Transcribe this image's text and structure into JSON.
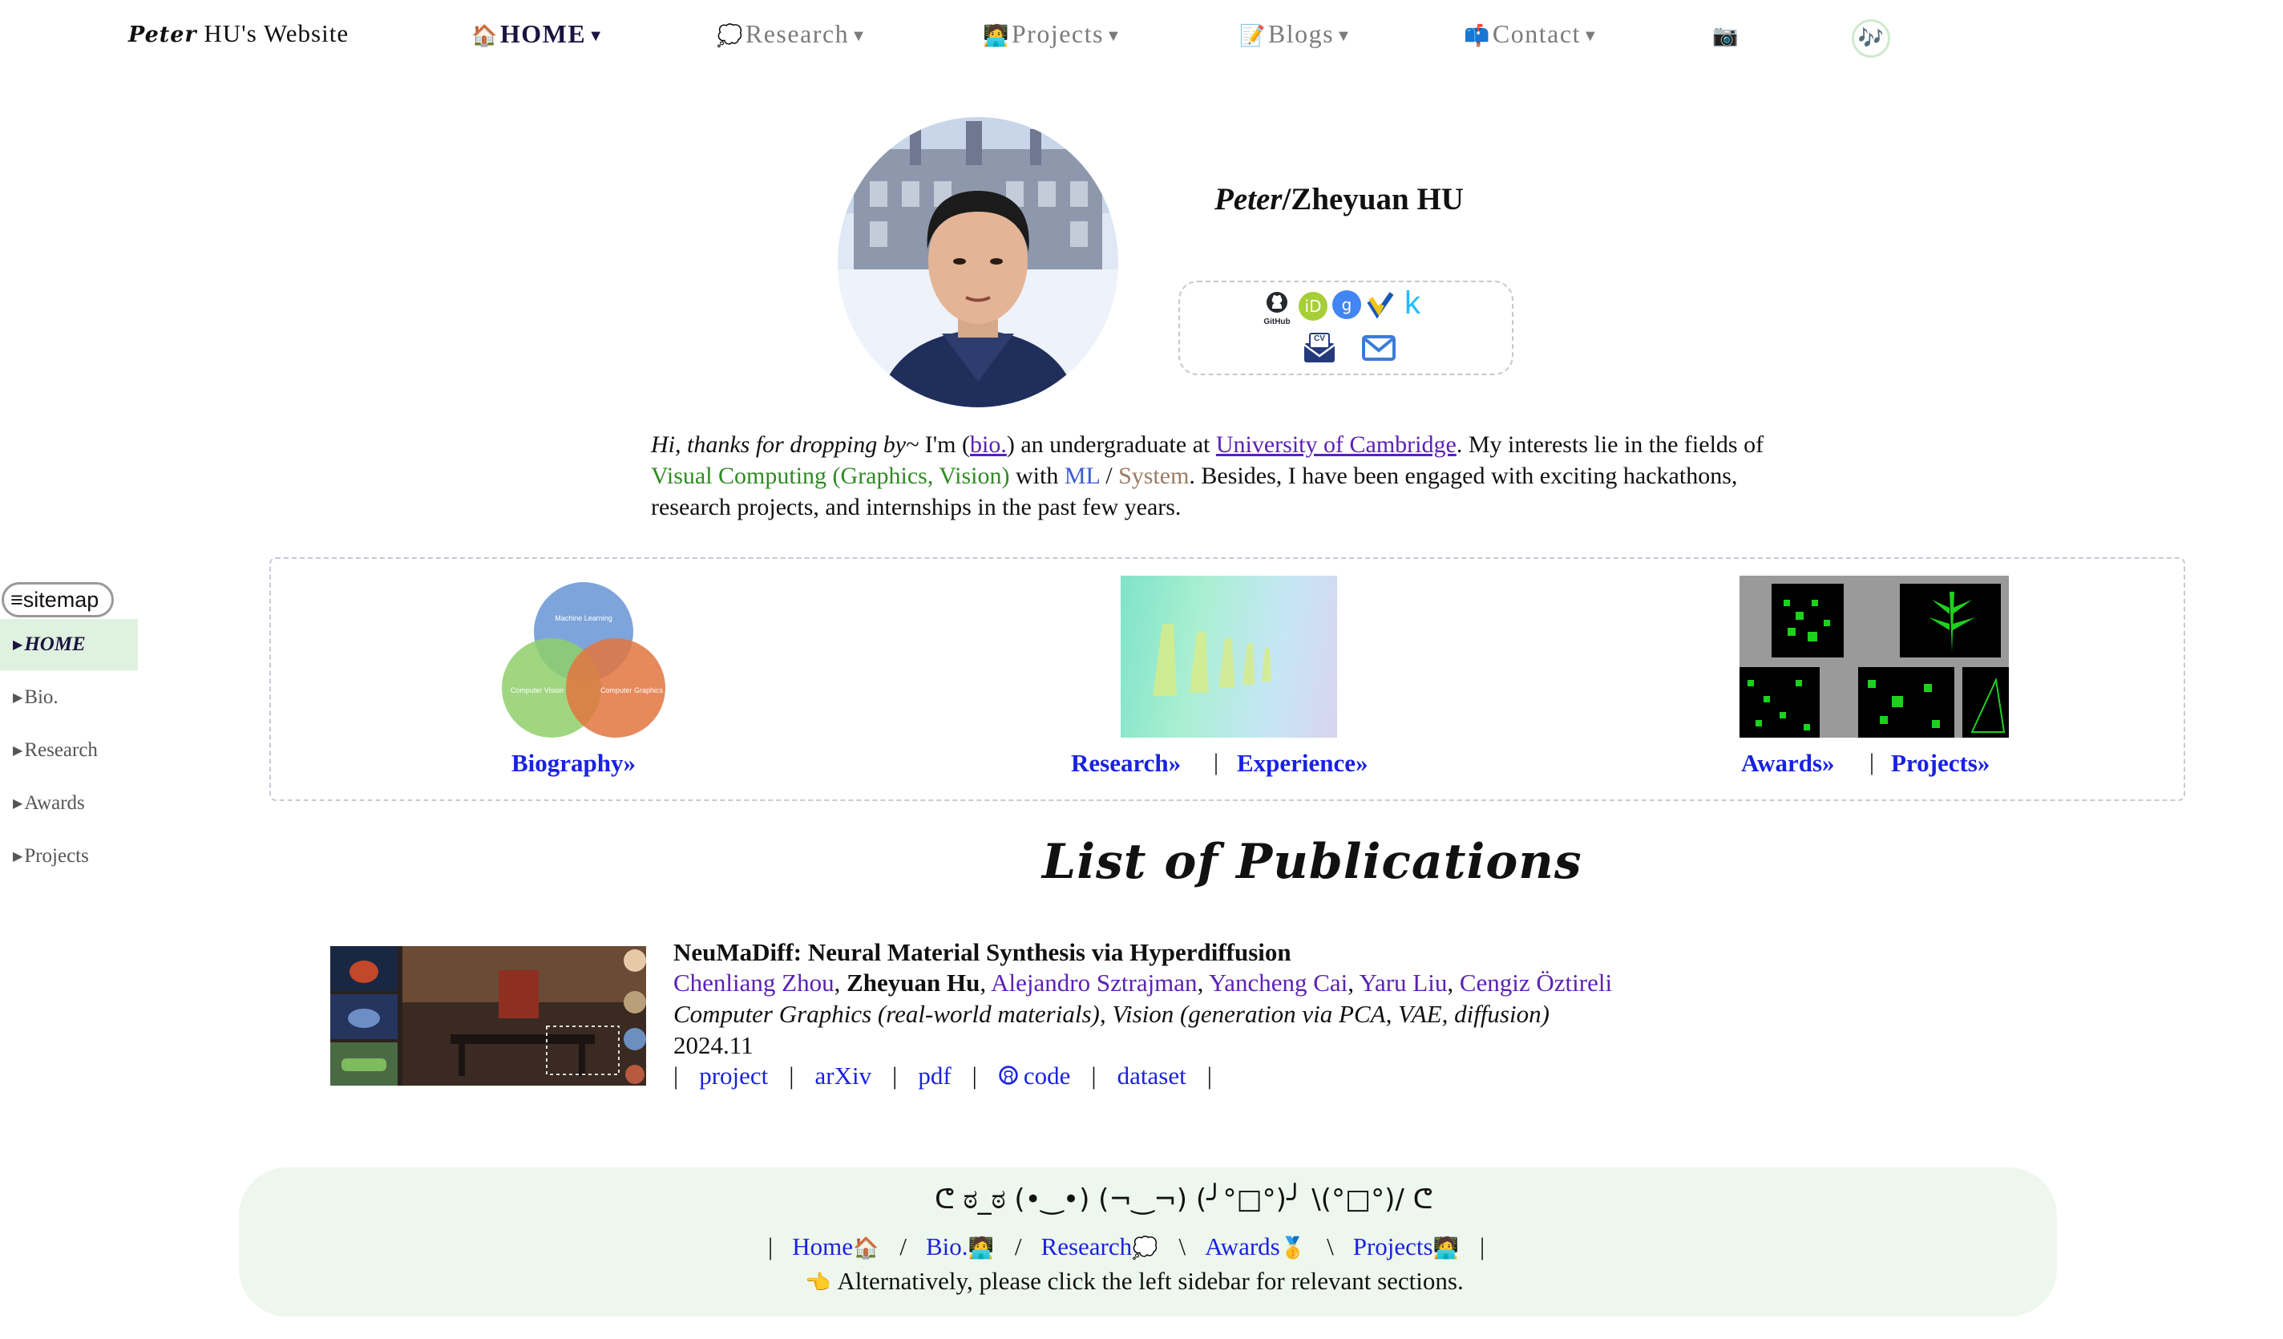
{
  "nav": {
    "brand": "Peter",
    "title_rest": " HU's Website",
    "items": [
      {
        "icon": "🏠",
        "label": "HOME"
      },
      {
        "icon": "💭",
        "label": "Research"
      },
      {
        "icon": "🧑‍💻",
        "label": "Projects"
      },
      {
        "icon": "📝",
        "label": "Blogs"
      },
      {
        "icon": "📫",
        "label": "Contact"
      }
    ],
    "camera_icon": "📷",
    "music_icon": "🎶"
  },
  "profile": {
    "nick": "Peter",
    "name_rest": "/Zheyuan HU",
    "links": [
      "GitHub",
      "ORCID",
      "Google Scholar",
      "Semantic Scholar",
      "Kaggle",
      "CV",
      "Email"
    ],
    "github_label": "GitHub",
    "cv_label": "CV"
  },
  "intro": {
    "greet": "Hi, thanks for dropping by~",
    "t1": " I'm (",
    "bio_link": "bio.",
    "t2": ") an undergraduate at ",
    "uni_link": "University of Cambridge",
    "t3": ". My interests lie in the fields of ",
    "vc": "Visual Computing (Graphics, Vision)",
    "t4": " with ",
    "ml": "ML",
    "t5": " / ",
    "sys": "System",
    "t6": ". Besides, I have been engaged with exciting hackathons, research projects, and internships in the past few years."
  },
  "sitemap": {
    "button": "≡sitemap",
    "items": [
      "HOME",
      "Bio.",
      "Research",
      "Awards",
      "Projects"
    ]
  },
  "cards": {
    "venn": {
      "ml": "Machine Learning",
      "cv": "Computer Vision",
      "cg": "Computer Graphics"
    },
    "biography": "Biography»",
    "research": "Research»",
    "experience": "Experience»",
    "awards": "Awards»",
    "projects": "Projects»",
    "sep": "|"
  },
  "publications": {
    "heading": "List of Publications",
    "items": [
      {
        "title": "NeuMaDiff: Neural Material Synthesis via Hyperdiffusion",
        "authors": [
          "Chenliang Zhou",
          "Zheyuan Hu",
          "Alejandro Sztrajman",
          "Yancheng Cai",
          "Yaru Liu",
          "Cengiz Öztireli"
        ],
        "topic": "Computer Graphics (real-world materials), Vision (generation via PCA, VAE, diffusion)",
        "date": "2024.11",
        "links": [
          "project",
          "arXiv",
          "pdf",
          "code",
          "dataset"
        ]
      }
    ]
  },
  "footer": {
    "kaomoji": "ᕦ ಠ_ಠ (•‿•) (¬‿¬) (╯°□°)╯ \\(°□°)/ ᕦ",
    "links": [
      {
        "label": "Home",
        "icon": "🏠"
      },
      {
        "label": "Bio.",
        "icon": "🧑‍💻"
      },
      {
        "label": "Research",
        "icon": "💭"
      },
      {
        "label": "Awards",
        "icon": "🥇"
      },
      {
        "label": "Projects",
        "icon": "🧑‍💻"
      }
    ],
    "separators": [
      "|",
      "/",
      "/",
      "\\",
      "\\",
      "|"
    ],
    "note_icon": "👈",
    "note": " Alternatively, please click the left sidebar for relevant sections."
  },
  "colors": {
    "link": "#1a22e0",
    "visited": "#5b21b6",
    "green": "#2e8b22",
    "sidebar_active": "#dff1df",
    "footer_bg": "#eef7ee"
  }
}
